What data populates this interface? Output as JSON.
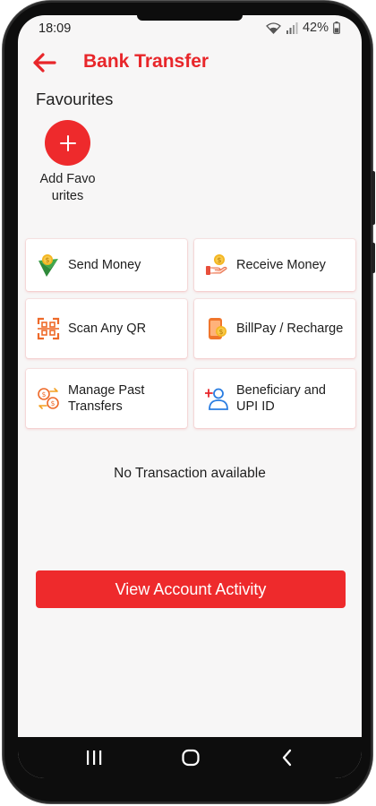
{
  "status_bar": {
    "time": "18:09",
    "battery": "42%",
    "icons": [
      "wifi-icon",
      "signal-icon",
      "battery-icon"
    ]
  },
  "header": {
    "title": "Bank Transfer",
    "back_icon": "arrow-left-icon"
  },
  "favourites": {
    "title": "Favourites",
    "add_label": "Add Favo urites",
    "add_icon": "plus-icon"
  },
  "tiles": [
    {
      "label": "Send Money",
      "icon": "send-money-icon"
    },
    {
      "label": "Receive Money",
      "icon": "receive-money-icon"
    },
    {
      "label": "Scan Any QR",
      "icon": "scan-qr-icon"
    },
    {
      "label": "BillPay / Recharge",
      "icon": "billpay-recharge-icon"
    },
    {
      "label": "Manage Past Transfers",
      "icon": "manage-transfers-icon"
    },
    {
      "label": "Beneficiary and UPI ID",
      "icon": "beneficiary-icon"
    }
  ],
  "empty_state": "No Transaction available",
  "cta": {
    "label": "View Account Activity"
  },
  "nav": {
    "recents_icon": "recents-icon",
    "home_icon": "home-icon",
    "back_icon": "back-chevron-icon"
  },
  "colors": {
    "accent": "#ee2a2c",
    "title": "#e8262a",
    "background": "#f7f6f6",
    "tile": "#ffffff"
  }
}
